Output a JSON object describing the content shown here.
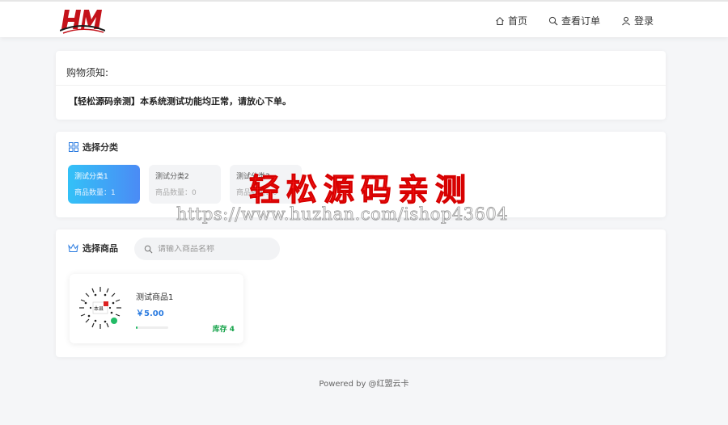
{
  "nav": {
    "home": "首页",
    "orders": "查看订单",
    "login": "登录"
  },
  "notice": {
    "title": "购物须知:",
    "body": "【轻松源码亲测】本系统测试功能均正常，请放心下单。"
  },
  "categories": {
    "title": "选择分类",
    "items": [
      {
        "name": "测试分类1",
        "count_label": "商品数量：1"
      },
      {
        "name": "测试分类2",
        "count_label": "商品数量：0"
      },
      {
        "name": "测试分类3",
        "count_label": "商品数量：0"
      }
    ]
  },
  "goods": {
    "title": "选择商品",
    "search_placeholder": "请输入商品名称",
    "items": [
      {
        "name": "测试商品1",
        "price": "￥5.00",
        "stock": "库存 4",
        "stock_fill": 0.05,
        "qr_label": "本县"
      }
    ]
  },
  "footer": "Powered by @红盟云卡",
  "watermark": {
    "title": "轻松源码亲测",
    "url": "https://www.huzhan.com/ishop43604"
  },
  "colors": {
    "accent": "#2a7be0",
    "active_gradient_start": "#33c1f7",
    "active_gradient_end": "#4b8bf5",
    "stock": "#16a34a",
    "watermark": "#ff1b1b"
  }
}
